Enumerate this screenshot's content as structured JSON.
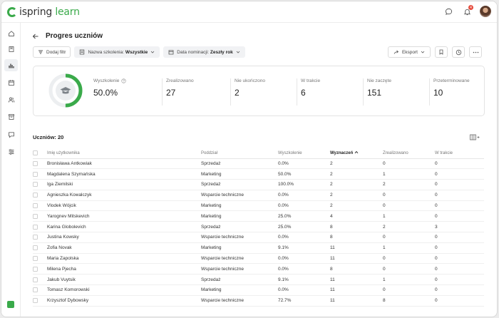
{
  "brand": {
    "name_a": "ispring",
    "name_b": " learn",
    "accent": "#3aaa4a"
  },
  "topbar": {
    "notification_count": "4"
  },
  "page": {
    "title": "Progres uczniów"
  },
  "filters": {
    "add_filter": "Dodaj filtr",
    "training_label": "Nazwa szkolenia: ",
    "training_value": "Wszystkie",
    "date_label": "Data nominacji: ",
    "date_value": "Zeszły rok"
  },
  "actions": {
    "export": "Eksport"
  },
  "stats": {
    "progress": 0.5,
    "items": [
      {
        "label": "Wyszkolenie",
        "value": "50.0%"
      },
      {
        "label": "Zrealizowano",
        "value": "27"
      },
      {
        "label": "Nie ukończono",
        "value": "2"
      },
      {
        "label": "W trakcie",
        "value": "6"
      },
      {
        "label": "Nie zaczęte",
        "value": "151"
      },
      {
        "label": "Przeterminowane",
        "value": "10"
      }
    ]
  },
  "table": {
    "count_label": "Uczniów: 20",
    "columns": [
      "Imię użytkownika",
      "Poddział",
      "Wyszkolenie",
      "Wyznaczeń",
      "Zrealizowano",
      "W trakcie"
    ],
    "rows": [
      [
        "Bronisława Antkowiak",
        "Sprzedaż",
        "0.0%",
        "2",
        "0",
        "0"
      ],
      [
        "Magdalena Szymańska",
        "Marketing",
        "50.0%",
        "2",
        "1",
        "0"
      ],
      [
        "Iga Ziemilski",
        "Sprzedaż",
        "100.0%",
        "2",
        "2",
        "0"
      ],
      [
        "Agnieszka Kowalczyk",
        "Wsparcie techniczne",
        "0.0%",
        "2",
        "0",
        "0"
      ],
      [
        "Vlodek Wójcik",
        "Marketing",
        "0.0%",
        "2",
        "0",
        "0"
      ],
      [
        "Yarognev Mitskevich",
        "Marketing",
        "25.0%",
        "4",
        "1",
        "0"
      ],
      [
        "Karina Globolevich",
        "Sprzedaż",
        "25.0%",
        "8",
        "2",
        "3"
      ],
      [
        "Justina Kowsky",
        "Wsparcie techniczne",
        "0.0%",
        "8",
        "0",
        "0"
      ],
      [
        "Zofia Novak",
        "Marketing",
        "9.1%",
        "11",
        "1",
        "0"
      ],
      [
        "Maria Zapolska",
        "Wsparcie techniczne",
        "0.0%",
        "11",
        "0",
        "0"
      ],
      [
        "Milena Pjecha",
        "Wsparcie techniczne",
        "0.0%",
        "8",
        "0",
        "0"
      ],
      [
        "Jakub Vuytsik",
        "Sprzedaż",
        "9.1%",
        "11",
        "1",
        "0"
      ],
      [
        "Tomasz Komorowski",
        "Marketing",
        "0.0%",
        "11",
        "0",
        "0"
      ],
      [
        "Krzysztof Dybowsky",
        "Wsparcie techniczne",
        "72.7%",
        "11",
        "8",
        "0"
      ]
    ]
  }
}
